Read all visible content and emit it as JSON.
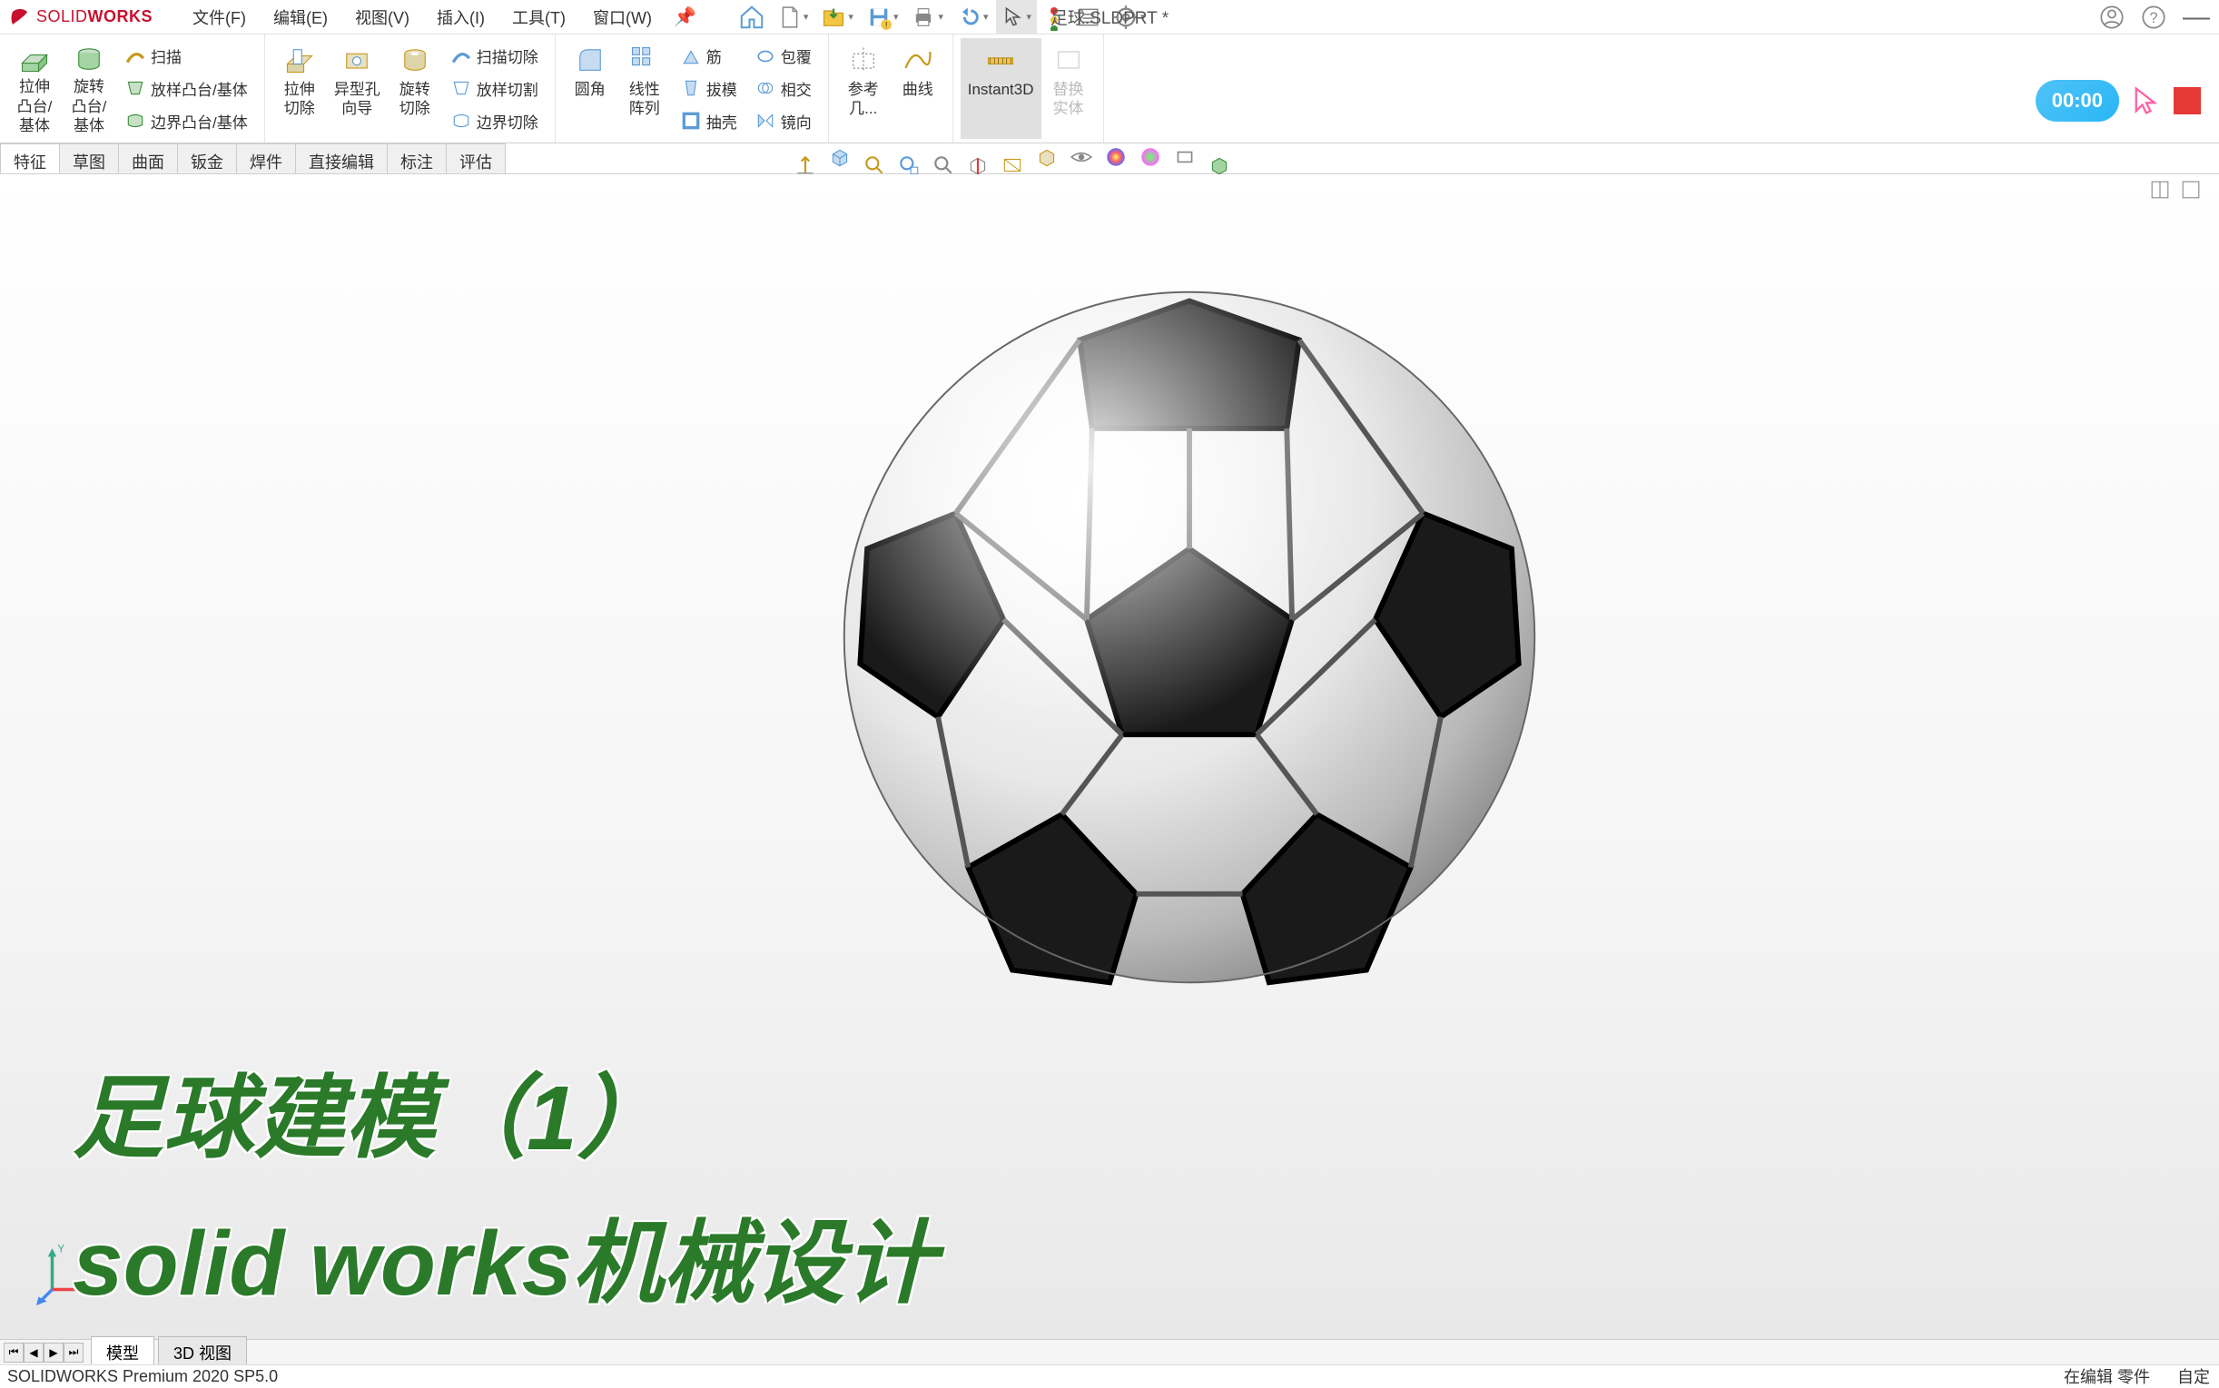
{
  "app": {
    "name": "SOLIDWORKS",
    "doc_title": "足球.SLDPRT *"
  },
  "menu": {
    "file": "文件(F)",
    "edit": "编辑(E)",
    "view": "视图(V)",
    "insert": "插入(I)",
    "tools": "工具(T)",
    "window": "窗口(W)"
  },
  "ribbon": {
    "boss_extrude": "拉伸\n凸台/\n基体",
    "boss_revolve": "旋转\n凸台/\n基体",
    "sweep": "扫描",
    "loft_boss": "放样凸台/基体",
    "boundary_boss": "边界凸台/基体",
    "cut_extrude": "拉伸\n切除",
    "hole_wizard": "异型孔\n向导",
    "cut_revolve": "旋转\n切除",
    "sweep_cut": "扫描切除",
    "loft_cut": "放样切割",
    "boundary_cut": "边界切除",
    "fillet": "圆角",
    "linear_pattern": "线性\n阵列",
    "rib": "筋",
    "draft": "拔模",
    "shell": "抽壳",
    "wrap": "包覆",
    "intersect": "相交",
    "mirror": "镜向",
    "ref_geom": "参考\n几...",
    "curves": "曲线",
    "instant3d": "Instant3D",
    "replace": "替换\n实体"
  },
  "feature_tabs": {
    "features": "特征",
    "sketch": "草图",
    "surface": "曲面",
    "sheetmetal": "钣金",
    "weldments": "焊件",
    "direct_edit": "直接编辑",
    "annotate": "标注",
    "evaluate": "评估"
  },
  "overlay": {
    "line1": "足球建模（1）",
    "line2": "solid works机械设计"
  },
  "recorder": {
    "time": "00:00"
  },
  "bottom_tabs": {
    "model": "模型",
    "view3d": "3D 视图"
  },
  "statusbar": {
    "product": "SOLIDWORKS Premium 2020 SP5.0",
    "mode": "在编辑 零件",
    "custom": "自定"
  }
}
